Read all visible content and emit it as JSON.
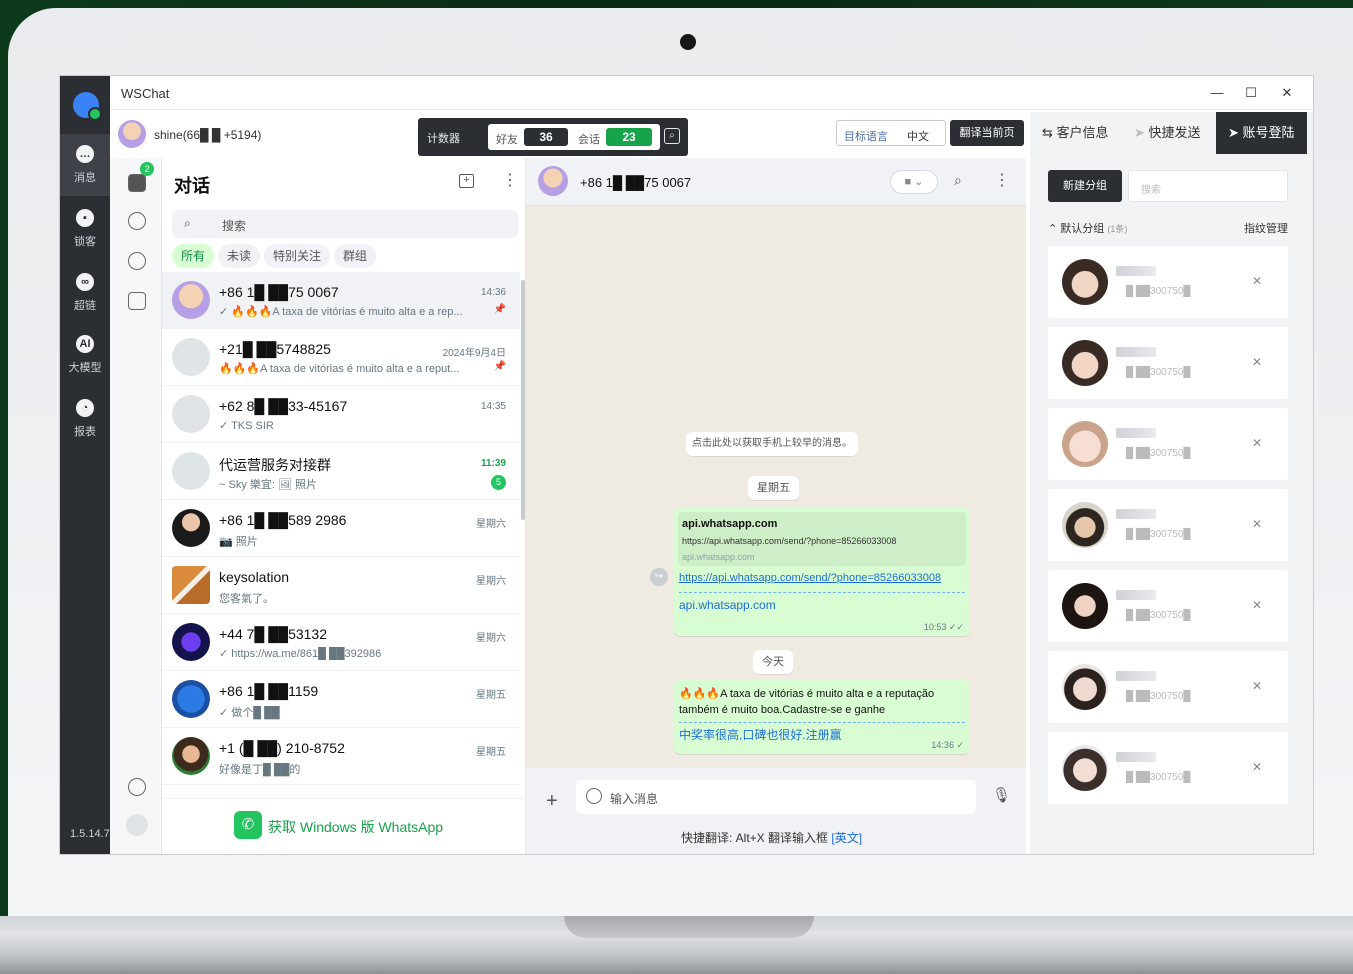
{
  "window": {
    "title": "WSChat",
    "controls": [
      "—",
      "☐",
      "✕"
    ],
    "version": "1.5.14.7"
  },
  "nav": {
    "items": [
      {
        "label": "消息",
        "icon": "chat-icon"
      },
      {
        "label": "锁客",
        "icon": "lock-icon"
      },
      {
        "label": "超链",
        "icon": "link-icon"
      },
      {
        "label": "大模型",
        "icon": "ai-icon"
      },
      {
        "label": "报表",
        "icon": "report-icon"
      }
    ]
  },
  "toolbar": {
    "account": "shine(66█ █ +5194)",
    "counter_label": "计数器",
    "friends_label": "好友",
    "friends_count": "36",
    "sessions_label": "会话",
    "sessions_count": "23",
    "target_lang_label": "目标语言",
    "target_lang_value": "中文",
    "translate_btn": "翻译当前页"
  },
  "right_tabs": [
    {
      "label": "客户信息",
      "icon": "swap-icon"
    },
    {
      "label": "快捷发送",
      "icon": "send-icon"
    },
    {
      "label": "账号登陆",
      "icon": "paper-plane-icon"
    }
  ],
  "iconcol": {
    "badge": "2"
  },
  "chatlist": {
    "title": "对话",
    "search_placeholder": "搜索",
    "filters": [
      "所有",
      "未读",
      "特别关注",
      "群组"
    ],
    "items": [
      {
        "name": "+86 1█ ██75 0067",
        "time": "14:36",
        "preview": "✓ 🔥🔥🔥A taxa de vitórias é muito alta e a rep...",
        "pinned": "📌"
      },
      {
        "name": "+21█ ██5748825",
        "time": "2024年9月4日",
        "preview": "🔥🔥🔥A taxa de vitórias é muito alta e a reput...",
        "pinned": "📌"
      },
      {
        "name": "+62 8█ ██33-45167",
        "time": "14:35",
        "preview": "✓ TKS SIR",
        "pinned": ""
      },
      {
        "name": "代运营服务对接群",
        "time": "11:39",
        "preview": "~ Sky 樂宜: 🖼 照片",
        "unread": "5"
      },
      {
        "name": "+86 1█ ██589 2986",
        "time": "星期六",
        "preview": "📷 照片"
      },
      {
        "name": "keysolation",
        "time": "星期六",
        "preview": "您客氣了。"
      },
      {
        "name": "+44 7█ ██53132",
        "time": "星期六",
        "preview": "✓ https://wa.me/861█ ██392986"
      },
      {
        "name": "+86 1█ ██1159",
        "time": "星期五",
        "preview": "✓ 做个█ ██"
      },
      {
        "name": "+1 (█ ██) 210-8752",
        "time": "星期五",
        "preview": "好像是丁█ ██的"
      }
    ],
    "get_whatsapp": "获取 Windows 版 WhatsApp"
  },
  "conversation": {
    "contact": "+86 1█ ██75 0067",
    "system_msg": "点击此处以获取手机上较早的消息。",
    "day1": "星期五",
    "day2": "今天",
    "msg1": {
      "preview_title": "api.whatsapp.com",
      "preview_url": "https://api.whatsapp.com/send/?phone=85266033008",
      "preview_domain": "api.whatsapp.com",
      "link": "https://api.whatsapp.com/send/?phone=85266033008",
      "translated": "api.whatsapp.com",
      "time": "10:53 ✓✓"
    },
    "msg2": {
      "text": "🔥🔥🔥A taxa de vitórias é muito alta e a reputação também é muito boa.Cadastre-se e ganhe",
      "translated": "中奖率很高,口碑也很好.注册赢",
      "time": "14:36 ✓"
    },
    "input_placeholder": "输入消息",
    "hint_prefix": "快捷翻译: Alt+X 翻译输入框 ",
    "hint_lang": "[英文]"
  },
  "rpanel": {
    "new_group": "新建分组",
    "search_placeholder": "搜索",
    "group_name": "默认分组",
    "group_count": "(1条)",
    "manage": "指纹管理",
    "contacts": [
      {
        "number": "█ ██300750█"
      },
      {
        "number": "█ ██300750█"
      },
      {
        "number": "█ ██300750█"
      },
      {
        "number": "█ ██300750█"
      },
      {
        "number": "█ ██300750█"
      },
      {
        "number": "█ ██300750█"
      },
      {
        "number": "█ ██300750█"
      }
    ]
  },
  "colors": {
    "accent": "#16a34a",
    "dark": "#2b2e33",
    "bubble": "#d9fdd3"
  }
}
